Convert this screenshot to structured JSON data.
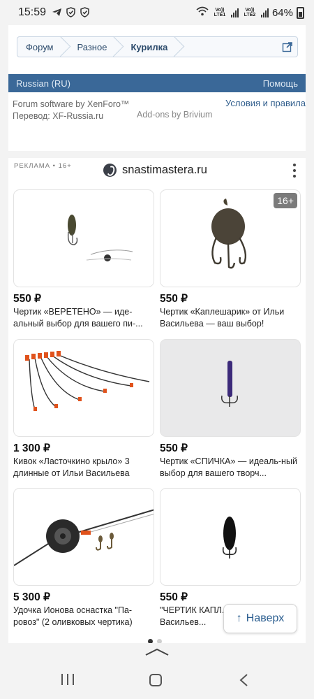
{
  "status_bar": {
    "time": "15:59",
    "battery": "64%",
    "sim1": "Vo)) LTE1",
    "sim2": "Vo)) LTE2"
  },
  "breadcrumbs": [
    "Форум",
    "Разное",
    "Курилка"
  ],
  "language_bar": {
    "language": "Russian (RU)",
    "help": "Помощь"
  },
  "credits": {
    "software": "Forum software by XenForo™",
    "translation": "Перевод: XF-Russia.ru",
    "addons": "Add-ons by Brivium",
    "terms": "Условия и правила"
  },
  "ad": {
    "label": "РЕКЛАМА • 16+",
    "domain": "snastimastera.ru",
    "age_badge": "16+",
    "items": [
      {
        "price": "550 ₽",
        "title": "Чертик «ВЕРЕТЕНО» — иде-альный выбор для вашего пи-..."
      },
      {
        "price": "550 ₽",
        "title": "Чертик «Каплешарик» от Ильи Васильева — ваш выбор!"
      },
      {
        "price": "1 300 ₽",
        "title": "Кивок «Ласточкино крыло» 3 длинные от Ильи Васильева"
      },
      {
        "price": "550 ₽",
        "title": "Чертик «СПИЧКА» — идеаль-ный выбор для вашего творч..."
      },
      {
        "price": "5 300 ₽",
        "title": "Удочка Ионова оснастка \"Па-ровоз\" (2 оливковых чертика)"
      },
      {
        "price": "550 ₽",
        "title": "\"ЧЕРТИК КАПЛ... Илья Васильев..."
      }
    ]
  },
  "scroll_top": {
    "label": "Наверх",
    "arrow": "↑"
  },
  "colors": {
    "accent": "#3a6898",
    "link": "#2f5d8c",
    "page_bg": "#f3f3f3"
  }
}
